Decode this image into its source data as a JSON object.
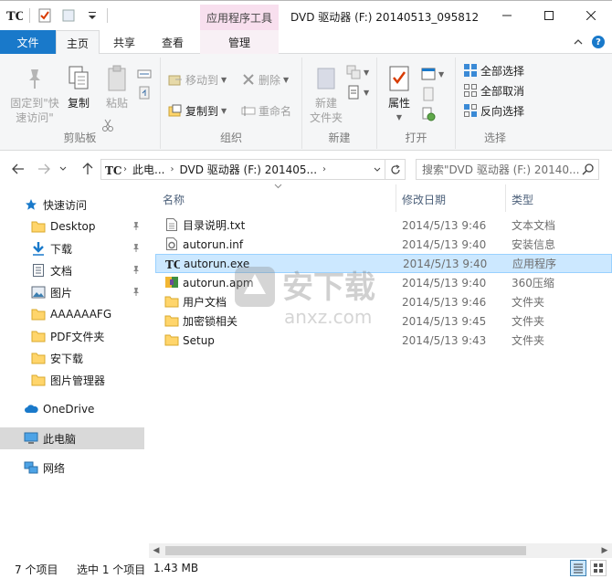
{
  "titlebar": {
    "context_tab_title": "应用程序工具",
    "window_title": "DVD 驱动器 (F:) 20140513_095812"
  },
  "tabs": {
    "file": "文件",
    "home": "主页",
    "share": "共享",
    "view": "查看",
    "manage": "管理"
  },
  "ribbon": {
    "clipboard": {
      "label": "剪贴板",
      "pin_quick_access": "固定到\"快\n速访问\"",
      "copy": "复制",
      "paste": "粘贴"
    },
    "organize": {
      "label": "组织",
      "move_to": "移动到",
      "copy_to": "复制到",
      "delete": "删除",
      "rename": "重命名"
    },
    "new": {
      "label": "新建",
      "new_folder": "新建\n文件夹"
    },
    "open": {
      "label": "打开",
      "properties": "属性"
    },
    "select": {
      "label": "选择",
      "select_all": "全部选择",
      "select_none": "全部取消",
      "invert": "反向选择"
    }
  },
  "address": {
    "crumb_pc": "此电...",
    "crumb_drive": "DVD 驱动器 (F:) 201405...",
    "search_placeholder": "搜索\"DVD 驱动器 (F:) 20140..."
  },
  "nav": {
    "quick_access": "快速访问",
    "items": [
      {
        "label": "Desktop",
        "icon": "folder-icon",
        "pinned": true
      },
      {
        "label": "下载",
        "icon": "download-icon",
        "pinned": true
      },
      {
        "label": "文档",
        "icon": "document-icon",
        "pinned": true
      },
      {
        "label": "图片",
        "icon": "picture-icon",
        "pinned": true
      },
      {
        "label": "AAAAAAFG",
        "icon": "folder-icon",
        "pinned": false
      },
      {
        "label": "PDF文件夹",
        "icon": "folder-icon",
        "pinned": false
      },
      {
        "label": "安下载",
        "icon": "folder-icon",
        "pinned": false
      },
      {
        "label": "图片管理器",
        "icon": "folder-icon",
        "pinned": false
      }
    ],
    "onedrive": "OneDrive",
    "this_pc": "此电脑",
    "network": "网络"
  },
  "columns": {
    "name": "名称",
    "date": "修改日期",
    "type": "类型"
  },
  "files": [
    {
      "name": "目录说明.txt",
      "date": "2014/5/13 9:46",
      "type": "文本文档",
      "icon": "text-file-icon"
    },
    {
      "name": "autorun.inf",
      "date": "2014/5/13 9:40",
      "type": "安装信息",
      "icon": "settings-file-icon"
    },
    {
      "name": "autorun.exe",
      "date": "2014/5/13 9:40",
      "type": "应用程序",
      "icon": "app-icon"
    },
    {
      "name": "autorun.apm",
      "date": "2014/5/13 9:40",
      "type": "360压缩",
      "icon": "archive-icon"
    },
    {
      "name": "用户文档",
      "date": "2014/5/13 9:46",
      "type": "文件夹",
      "icon": "folder-icon"
    },
    {
      "name": "加密锁相关",
      "date": "2014/5/13 9:45",
      "type": "文件夹",
      "icon": "folder-icon"
    },
    {
      "name": "Setup",
      "date": "2014/5/13 9:43",
      "type": "文件夹",
      "icon": "folder-icon"
    }
  ],
  "status": {
    "count": "7 个项目",
    "selected": "选中 1 个项目",
    "size": "1.43 MB"
  },
  "watermark": {
    "text_cn": "安下载",
    "text_en": "anxz.com"
  },
  "colors": {
    "accent": "#1979ca",
    "context_tab": "#f8dfee",
    "selection": "#cce8ff",
    "folder": "#ffd56b"
  }
}
